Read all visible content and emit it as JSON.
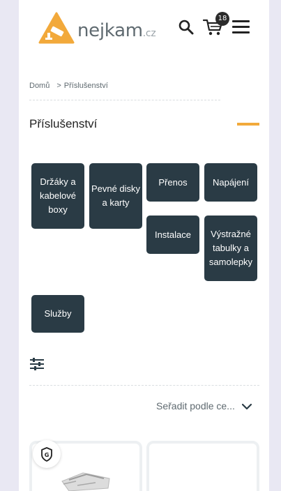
{
  "header": {
    "logo_text": "nejkam",
    "logo_tld": ".cz",
    "cart_count": "18"
  },
  "breadcrumb": {
    "home": "Domů",
    "separator": ">",
    "current": "Příslušenství"
  },
  "section": {
    "title": "Příslušenství"
  },
  "categories": [
    {
      "label": "Držáky a kabelové boxy"
    },
    {
      "label": "Pevné disky a karty"
    },
    {
      "label": "Přenos"
    },
    {
      "label": "Napájení"
    },
    {
      "label": "Instalace"
    },
    {
      "label": "Výstražné tabulky a samolepky"
    },
    {
      "label": "Služby"
    }
  ],
  "toolbar": {
    "sort_label": "Seřadit podle ce..."
  },
  "colors": {
    "accent": "#f2a93b",
    "category_bg": "#2a3b45",
    "logo_mark": "#f2a93b",
    "page_bg": "#e9e8f3"
  },
  "icons": {
    "search": "search-icon",
    "cart": "cart-icon",
    "menu": "hamburger-menu-icon",
    "filter": "filter-sliders-icon",
    "sort": "chevron-down-icon",
    "badge": "shield-g-icon"
  }
}
